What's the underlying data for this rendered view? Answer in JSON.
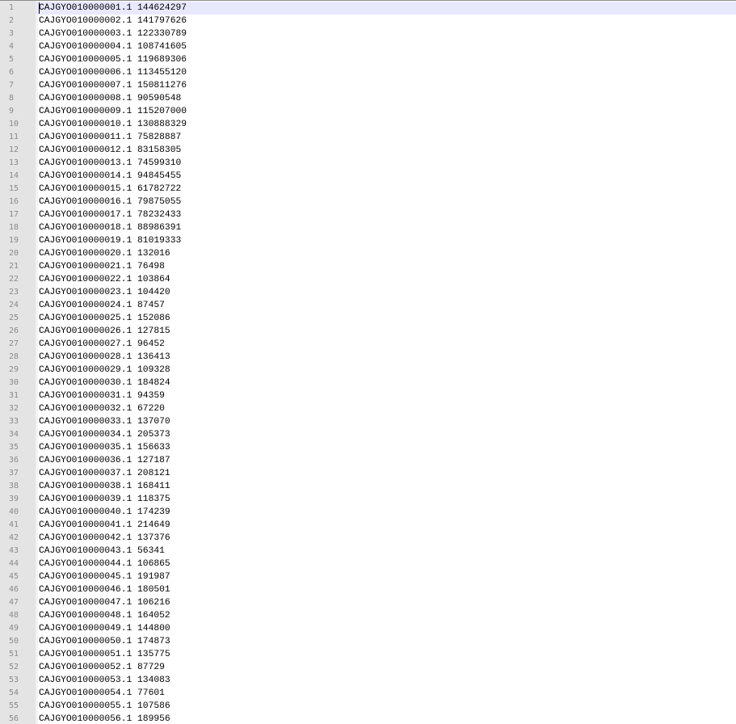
{
  "editor": {
    "current_line": 1,
    "lines": [
      "CAJGYO010000001.1 144624297",
      "CAJGYO010000002.1 141797626",
      "CAJGYO010000003.1 122330789",
      "CAJGYO010000004.1 108741605",
      "CAJGYO010000005.1 119689306",
      "CAJGYO010000006.1 113455120",
      "CAJGYO010000007.1 150811276",
      "CAJGYO010000008.1 90590548",
      "CAJGYO010000009.1 115207000",
      "CAJGYO010000010.1 130888329",
      "CAJGYO010000011.1 75828887",
      "CAJGYO010000012.1 83158305",
      "CAJGYO010000013.1 74599310",
      "CAJGYO010000014.1 94845455",
      "CAJGYO010000015.1 61782722",
      "CAJGYO010000016.1 79875055",
      "CAJGYO010000017.1 78232433",
      "CAJGYO010000018.1 88986391",
      "CAJGYO010000019.1 81019333",
      "CAJGYO010000020.1 132016",
      "CAJGYO010000021.1 76498",
      "CAJGYO010000022.1 103864",
      "CAJGYO010000023.1 104420",
      "CAJGYO010000024.1 87457",
      "CAJGYO010000025.1 152086",
      "CAJGYO010000026.1 127815",
      "CAJGYO010000027.1 96452",
      "CAJGYO010000028.1 136413",
      "CAJGYO010000029.1 109328",
      "CAJGYO010000030.1 184824",
      "CAJGYO010000031.1 94359",
      "CAJGYO010000032.1 67220",
      "CAJGYO010000033.1 137070",
      "CAJGYO010000034.1 205373",
      "CAJGYO010000035.1 156633",
      "CAJGYO010000036.1 127187",
      "CAJGYO010000037.1 208121",
      "CAJGYO010000038.1 168411",
      "CAJGYO010000039.1 118375",
      "CAJGYO010000040.1 174239",
      "CAJGYO010000041.1 214649",
      "CAJGYO010000042.1 137376",
      "CAJGYO010000043.1 56341",
      "CAJGYO010000044.1 106865",
      "CAJGYO010000045.1 191987",
      "CAJGYO010000046.1 180501",
      "CAJGYO010000047.1 106216",
      "CAJGYO010000048.1 164052",
      "CAJGYO010000049.1 144800",
      "CAJGYO010000050.1 174873",
      "CAJGYO010000051.1 135775",
      "CAJGYO010000052.1 87729",
      "CAJGYO010000053.1 134083",
      "CAJGYO010000054.1 77601",
      "CAJGYO010000055.1 107586",
      "CAJGYO010000056.1 189956"
    ]
  },
  "colors": {
    "gutter_background": "#e4e4e4",
    "current_line_highlight": "#e8e8ff",
    "line_number_text": "#8a8a8a",
    "text": "#000000"
  }
}
